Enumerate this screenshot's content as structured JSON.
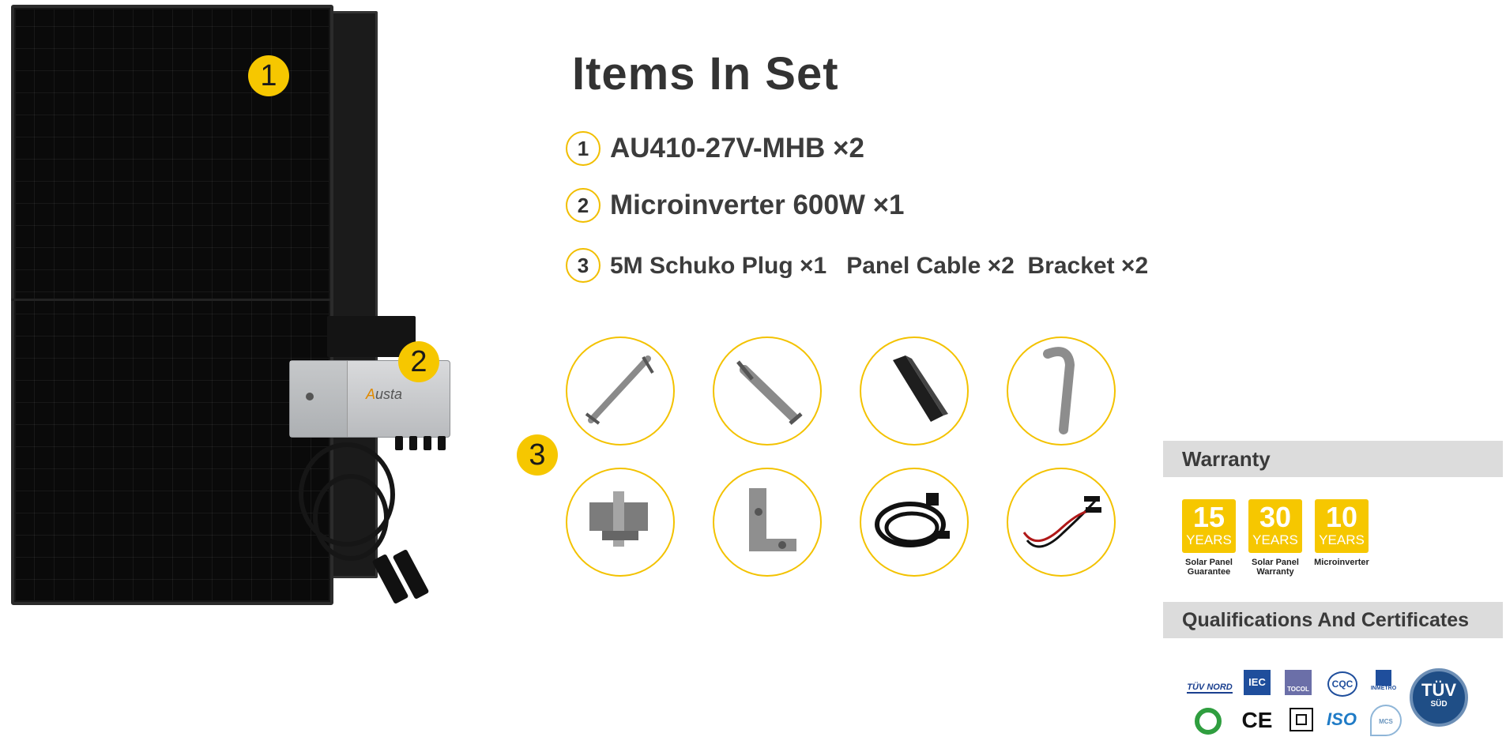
{
  "heading": "Items In Set",
  "items": [
    {
      "num": "1",
      "text": "AU410-27V-MHB ×2"
    },
    {
      "num": "2",
      "text": "Microinverter 600W ×1"
    },
    {
      "num": "3",
      "text": "5M Schuko Plug ×1   Panel Cable ×2  Bracket ×2"
    }
  ],
  "callouts": {
    "panel": "1",
    "inverter": "2",
    "accessories": "3"
  },
  "inverter_brand": "Austa",
  "accessories": [
    "bracket-arm-icon",
    "adjustable-bracket-icon",
    "rail-icon",
    "roof-hook-icon",
    "clamp-icon",
    "l-bracket-icon",
    "schuko-cable-icon",
    "panel-cable-icon"
  ],
  "warranty": {
    "title": "Warranty",
    "tiles": [
      {
        "years": "15",
        "unit": "YEARS",
        "caption1": "Solar Panel",
        "caption2": "Guarantee"
      },
      {
        "years": "30",
        "unit": "YEARS",
        "caption1": "Solar Panel",
        "caption2": "Warranty"
      },
      {
        "years": "10",
        "unit": "YEARS",
        "caption1": "Microinverter",
        "caption2": ""
      }
    ]
  },
  "certificates": {
    "title": "Qualifications And Certificates",
    "row1": [
      "TÜV NORD",
      "IEC",
      "TOCOL",
      "CQC",
      "INMETRO"
    ],
    "row2": [
      "",
      "CE",
      "",
      "ISO",
      "MCS"
    ],
    "tuv_sud": {
      "line1": "TÜV",
      "line2": "SÜD"
    }
  },
  "colors": {
    "accent": "#f6c700",
    "text": "#333333",
    "bar": "#dcdcdc",
    "panel": "#0a0a0a"
  }
}
